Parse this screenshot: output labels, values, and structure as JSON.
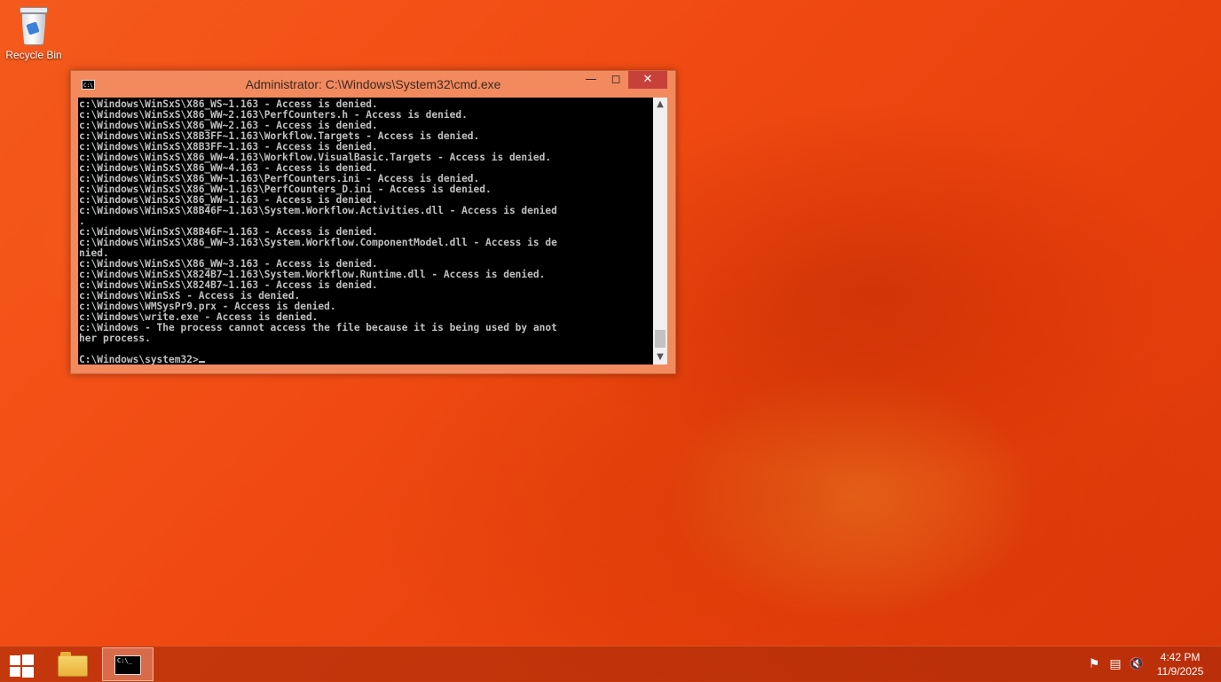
{
  "desktop": {
    "icons": [
      {
        "label": "Recycle Bin",
        "icon": "recycle-bin-icon"
      }
    ]
  },
  "window": {
    "title": "Administrator: C:\\Windows\\System32\\cmd.exe",
    "icon": "cmd-icon",
    "controls": {
      "minimize": "minimize-icon",
      "maximize": "maximize-icon",
      "close": "close-icon"
    },
    "console_lines": [
      "c:\\Windows\\WinSxS\\X86_WS~1.163 - Access is denied.",
      "c:\\Windows\\WinSxS\\X86_WW~2.163\\PerfCounters.h - Access is denied.",
      "c:\\Windows\\WinSxS\\X86_WW~2.163 - Access is denied.",
      "c:\\Windows\\WinSxS\\X8B3FF~1.163\\Workflow.Targets - Access is denied.",
      "c:\\Windows\\WinSxS\\X8B3FF~1.163 - Access is denied.",
      "c:\\Windows\\WinSxS\\X86_WW~4.163\\Workflow.VisualBasic.Targets - Access is denied.",
      "c:\\Windows\\WinSxS\\X86_WW~4.163 - Access is denied.",
      "c:\\Windows\\WinSxS\\X86_WW~1.163\\PerfCounters.ini - Access is denied.",
      "c:\\Windows\\WinSxS\\X86_WW~1.163\\PerfCounters_D.ini - Access is denied.",
      "c:\\Windows\\WinSxS\\X86_WW~1.163 - Access is denied.",
      "c:\\Windows\\WinSxS\\X8B46F~1.163\\System.Workflow.Activities.dll - Access is denied",
      ".",
      "c:\\Windows\\WinSxS\\X8B46F~1.163 - Access is denied.",
      "c:\\Windows\\WinSxS\\X86_WW~3.163\\System.Workflow.ComponentModel.dll - Access is de",
      "nied.",
      "c:\\Windows\\WinSxS\\X86_WW~3.163 - Access is denied.",
      "c:\\Windows\\WinSxS\\X824B7~1.163\\System.Workflow.Runtime.dll - Access is denied.",
      "c:\\Windows\\WinSxS\\X824B7~1.163 - Access is denied.",
      "c:\\Windows\\WinSxS - Access is denied.",
      "c:\\Windows\\WMSysPr9.prx - Access is denied.",
      "c:\\Windows\\write.exe - Access is denied.",
      "c:\\Windows - The process cannot access the file because it is being used by anot",
      "her process.",
      "",
      "C:\\Windows\\system32>"
    ]
  },
  "taskbar": {
    "start_icon": "windows-start-icon",
    "pinned": [
      {
        "name": "file-explorer",
        "icon": "folder-icon",
        "active": false
      },
      {
        "name": "command-prompt",
        "icon": "cmd-icon",
        "active": true
      }
    ],
    "tray": [
      "action-center-flag-icon",
      "network-icon",
      "volume-muted-icon"
    ],
    "time": "4:42 PM",
    "date": "11/9/2025"
  }
}
